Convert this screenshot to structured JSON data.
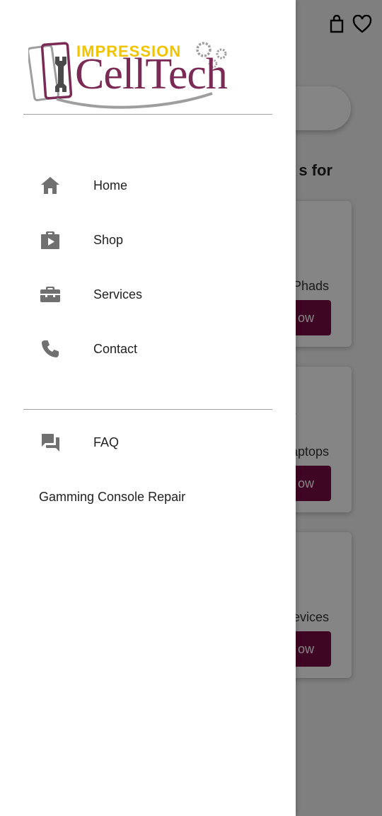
{
  "drawer": {
    "logo": {
      "top_text": "IMPRESSION",
      "main_text": "CellTech",
      "colors": {
        "purple": "#7b2a56",
        "yellow": "#f2c300",
        "gray": "#9e9e9e"
      }
    },
    "primary_items": [
      {
        "label": "Home",
        "icon": "home-icon"
      },
      {
        "label": "Shop",
        "icon": "shop-icon"
      },
      {
        "label": "Services",
        "icon": "toolbox-icon"
      },
      {
        "label": "Contact",
        "icon": "phone-icon"
      }
    ],
    "secondary_items": [
      {
        "label": "FAQ",
        "icon": "forum-icon"
      },
      {
        "label": "Gamming Console Repair"
      }
    ]
  },
  "background": {
    "heading_fragment": "s for",
    "cards": [
      {
        "label_fragment": "Phads",
        "button_fragment": "ow"
      },
      {
        "label_fragment": "aptops",
        "button_fragment": "ow"
      },
      {
        "label_fragment": "evices",
        "button_fragment": "ow"
      }
    ],
    "accent": "#7a0d45"
  }
}
